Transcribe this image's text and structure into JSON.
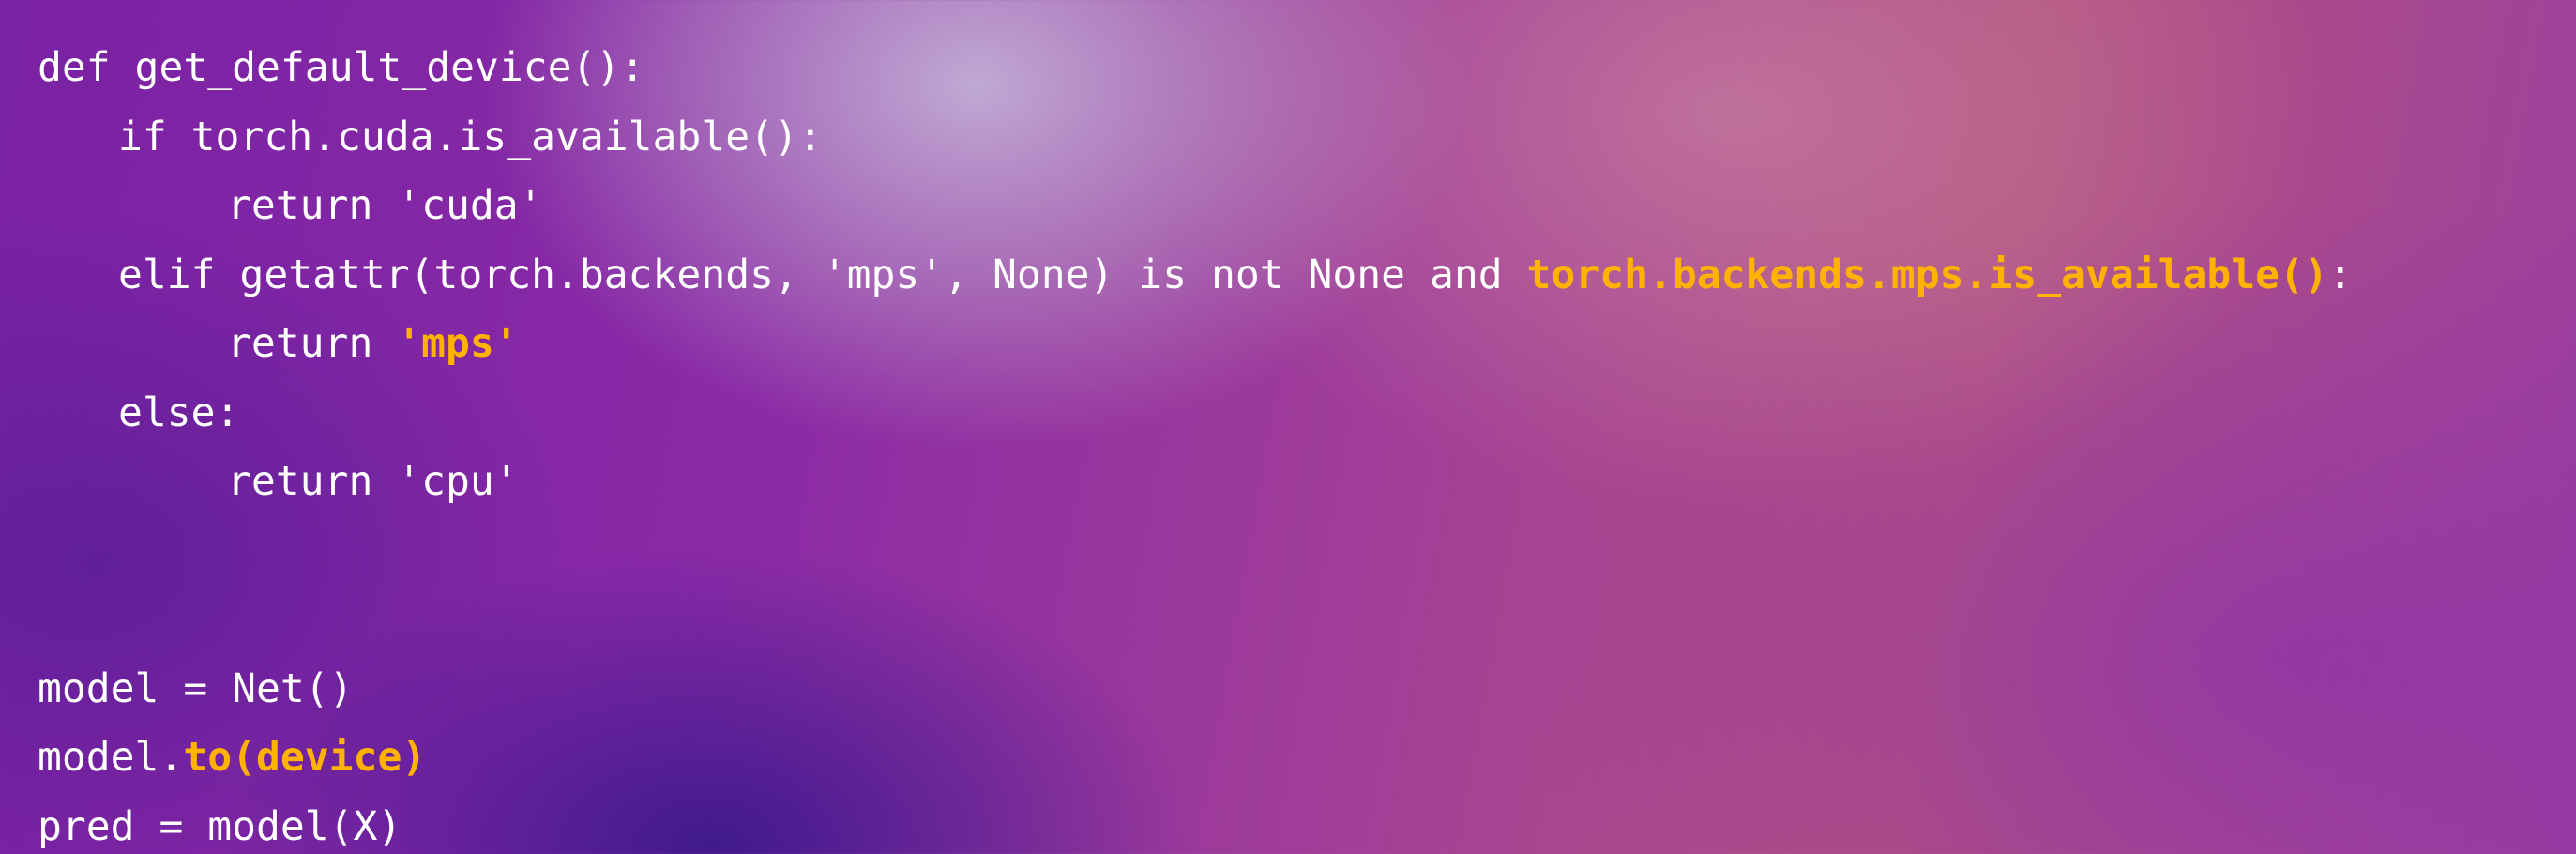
{
  "slide": {
    "accent_color": "#ffb300",
    "text_color": "#ffffff"
  },
  "code": {
    "l1": "def get_default_device():",
    "l2": "if torch.cuda.is_available():",
    "l3": "return 'cuda'",
    "l4_a": "elif getattr(torch.backends, 'mps', None) is not None and ",
    "l4_b": "torch.backends.mps.is_available()",
    "l4_c": ":",
    "l5_a": "return ",
    "l5_b": "'mps'",
    "l6": "else:",
    "l7": "return 'cpu'",
    "l8": "",
    "l9": "model = Net()",
    "l10_a": "model.",
    "l10_b": "to(device)",
    "l11": "pred = model(X)"
  }
}
